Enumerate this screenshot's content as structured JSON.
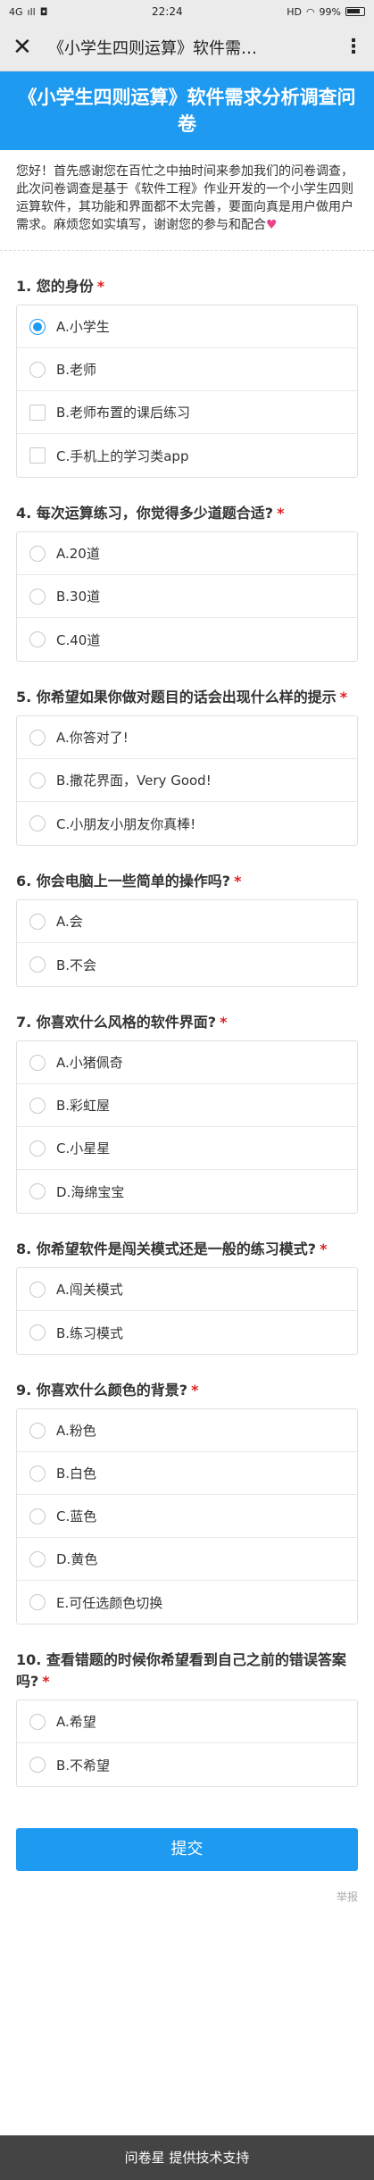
{
  "status_bar": {
    "signal": "4G",
    "time": "22:24",
    "indicators": "HD",
    "battery": "99%"
  },
  "nav": {
    "title": "《小学生四则运算》软件需…",
    "close_icon": "close-icon",
    "more_icon": "more-vertical-icon"
  },
  "banner": {
    "title": "《小学生四则运算》软件需求分析调查问卷"
  },
  "intro": {
    "text": "您好！首先感谢您在百忙之中抽时间来参加我们的问卷调查，此次问卷调查是基于《软件工程》作业开发的一个小学生四则运算软件，其功能和界面都不太完善，要面向真是用户做用户需求。麻烦您如实填写，谢谢您的参与和配合",
    "heart": "♥"
  },
  "questions": [
    {
      "title": "1. 您的身份",
      "required": "*",
      "options": [
        {
          "label": "A.小学生",
          "type": "radio",
          "checked": true
        },
        {
          "label": "B.老师",
          "type": "radio",
          "checked": false
        },
        {
          "label": "B.老师布置的课后练习",
          "type": "checkbox",
          "checked": false
        },
        {
          "label": "C.手机上的学习类app",
          "type": "checkbox",
          "checked": false
        }
      ]
    },
    {
      "title": "4. 每次运算练习，你觉得多少道题合适?",
      "required": "*",
      "options": [
        {
          "label": "A.20道",
          "type": "radio",
          "checked": false
        },
        {
          "label": "B.30道",
          "type": "radio",
          "checked": false
        },
        {
          "label": "C.40道",
          "type": "radio",
          "checked": false
        }
      ]
    },
    {
      "title": "5. 你希望如果你做对题目的话会出现什么样的提示",
      "required": "*",
      "options": [
        {
          "label": "A.你答对了!",
          "type": "radio",
          "checked": false
        },
        {
          "label": "B.撒花界面，Very Good!",
          "type": "radio",
          "checked": false
        },
        {
          "label": "C.小朋友小朋友你真棒!",
          "type": "radio",
          "checked": false
        }
      ]
    },
    {
      "title": "6. 你会电脑上一些简单的操作吗?",
      "required": "*",
      "options": [
        {
          "label": "A.会",
          "type": "radio",
          "checked": false
        },
        {
          "label": "B.不会",
          "type": "radio",
          "checked": false
        }
      ]
    },
    {
      "title": "7. 你喜欢什么风格的软件界面?",
      "required": "*",
      "options": [
        {
          "label": "A.小猪佩奇",
          "type": "radio",
          "checked": false
        },
        {
          "label": "B.彩虹屋",
          "type": "radio",
          "checked": false
        },
        {
          "label": "C.小星星",
          "type": "radio",
          "checked": false
        },
        {
          "label": "D.海绵宝宝",
          "type": "radio",
          "checked": false
        }
      ]
    },
    {
      "title": "8. 你希望软件是闯关模式还是一般的练习模式?",
      "required": "*",
      "options": [
        {
          "label": "A.闯关模式",
          "type": "radio",
          "checked": false
        },
        {
          "label": "B.练习模式",
          "type": "radio",
          "checked": false
        }
      ]
    },
    {
      "title": "9. 你喜欢什么颜色的背景?",
      "required": "*",
      "options": [
        {
          "label": "A.粉色",
          "type": "radio",
          "checked": false
        },
        {
          "label": "B.白色",
          "type": "radio",
          "checked": false
        },
        {
          "label": "C.蓝色",
          "type": "radio",
          "checked": false
        },
        {
          "label": "D.黄色",
          "type": "radio",
          "checked": false
        },
        {
          "label": "E.可任选颜色切换",
          "type": "radio",
          "checked": false
        }
      ]
    },
    {
      "title": "10. 查看错题的时候你希望看到自己之前的错误答案吗?",
      "required": "*",
      "options": [
        {
          "label": "A.希望",
          "type": "radio",
          "checked": false
        },
        {
          "label": "B.不希望",
          "type": "radio",
          "checked": false
        }
      ]
    }
  ],
  "submit": {
    "label": "提交"
  },
  "report": {
    "label": "举报"
  },
  "footer": {
    "text": "问卷星 提供技术支持"
  },
  "colors": {
    "accent": "#1e9af0",
    "required": "#e01e1e",
    "footer": "#444444"
  }
}
